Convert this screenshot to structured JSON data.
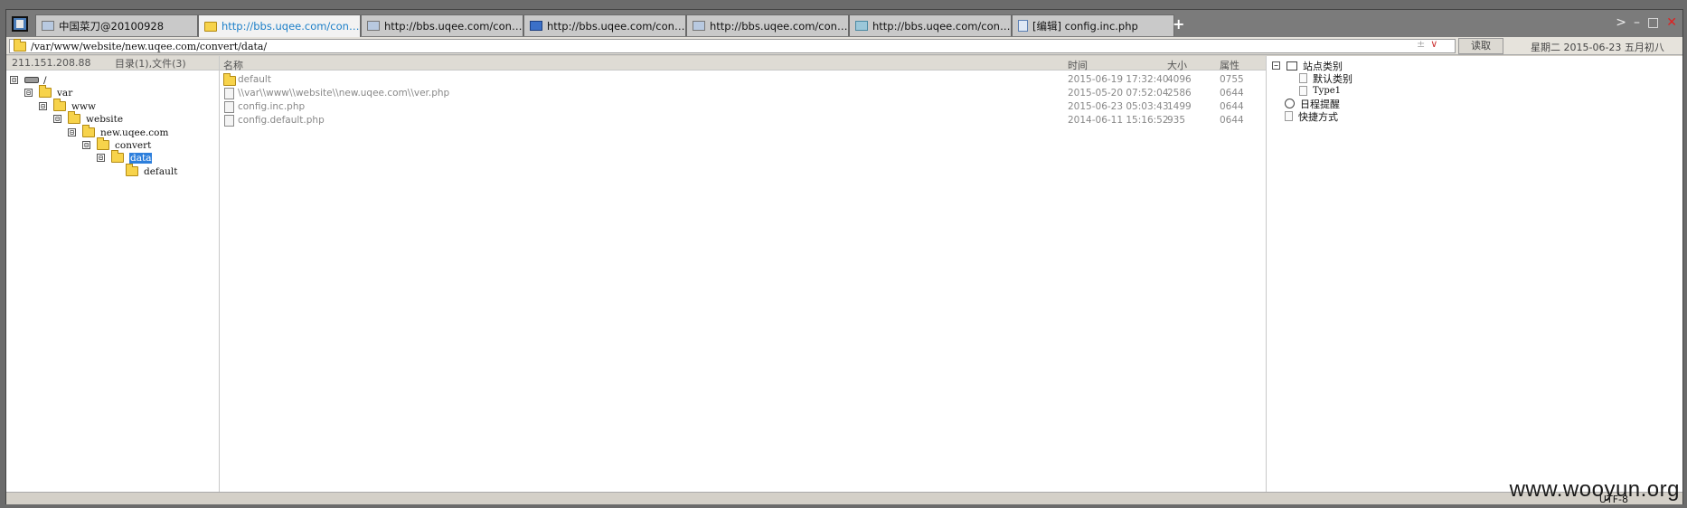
{
  "tabs": [
    {
      "label": "中国菜刀@20100928",
      "icon": "app-tab-icon",
      "active": false
    },
    {
      "label": "http://bbs.uqee.com/convert...",
      "icon": "folder-icon",
      "active": true
    },
    {
      "label": "http://bbs.uqee.com/convert...",
      "icon": "globe-icon",
      "active": false
    },
    {
      "label": "http://bbs.uqee.com/convert...",
      "icon": "terminal-icon",
      "active": false
    },
    {
      "label": "http://bbs.uqee.com/convert...",
      "icon": "globe-icon",
      "active": false
    },
    {
      "label": "http://bbs.uqee.com/convert...",
      "icon": "database-icon",
      "active": false
    },
    {
      "label": "[编辑] config.inc.php",
      "icon": "page-icon",
      "active": false
    }
  ],
  "new_tab": "+",
  "window_controls": {
    "next": ">",
    "minimize": "–",
    "maximize": "□",
    "close": "✕"
  },
  "address": {
    "path": "/var/www/website/new.uqee.com/convert/data/",
    "extra_glyph": "±",
    "dropdown_glyph": "∨",
    "read_label": "读取"
  },
  "date": "星期二 2015-06-23 五月初八",
  "tree": {
    "ip": "211.151.208.88",
    "summary": "目录(1),文件(3)",
    "nodes": [
      {
        "label": "/",
        "expander": "⊟"
      },
      {
        "label": "var",
        "expander": "⊟"
      },
      {
        "label": "www",
        "expander": "⊟"
      },
      {
        "label": "website",
        "expander": "⊟"
      },
      {
        "label": "new.uqee.com",
        "expander": "⊟"
      },
      {
        "label": "convert",
        "expander": "⊟"
      },
      {
        "label": "data",
        "expander": "⊟",
        "selected": true
      },
      {
        "label": "default",
        "expander": ""
      }
    ]
  },
  "files": {
    "columns": {
      "name": "名称",
      "time": "时间",
      "size": "大小",
      "attr": "属性"
    },
    "rows": [
      {
        "name": "default",
        "time": "2015-06-19 17:32:40",
        "size": "4096",
        "attr": "0755",
        "type": "folder"
      },
      {
        "name": "\\\\var\\\\www\\\\website\\\\new.uqee.com\\\\ver.php",
        "time": "2015-05-20 07:52:04",
        "size": "2586",
        "attr": "0644",
        "type": "file"
      },
      {
        "name": "config.inc.php",
        "time": "2015-06-23 05:03:43",
        "size": "1499",
        "attr": "0644",
        "type": "file"
      },
      {
        "name": "config.default.php",
        "time": "2014-06-11 15:16:52",
        "size": "935",
        "attr": "0644",
        "type": "file"
      }
    ]
  },
  "side": {
    "site_category": "站点类别",
    "default_category": "默认类别",
    "type1": "Type1",
    "schedule": "日程提醒",
    "shortcuts": "快捷方式"
  },
  "status": {
    "encoding": "UTF-8"
  },
  "watermark": "www.wooyun.org"
}
